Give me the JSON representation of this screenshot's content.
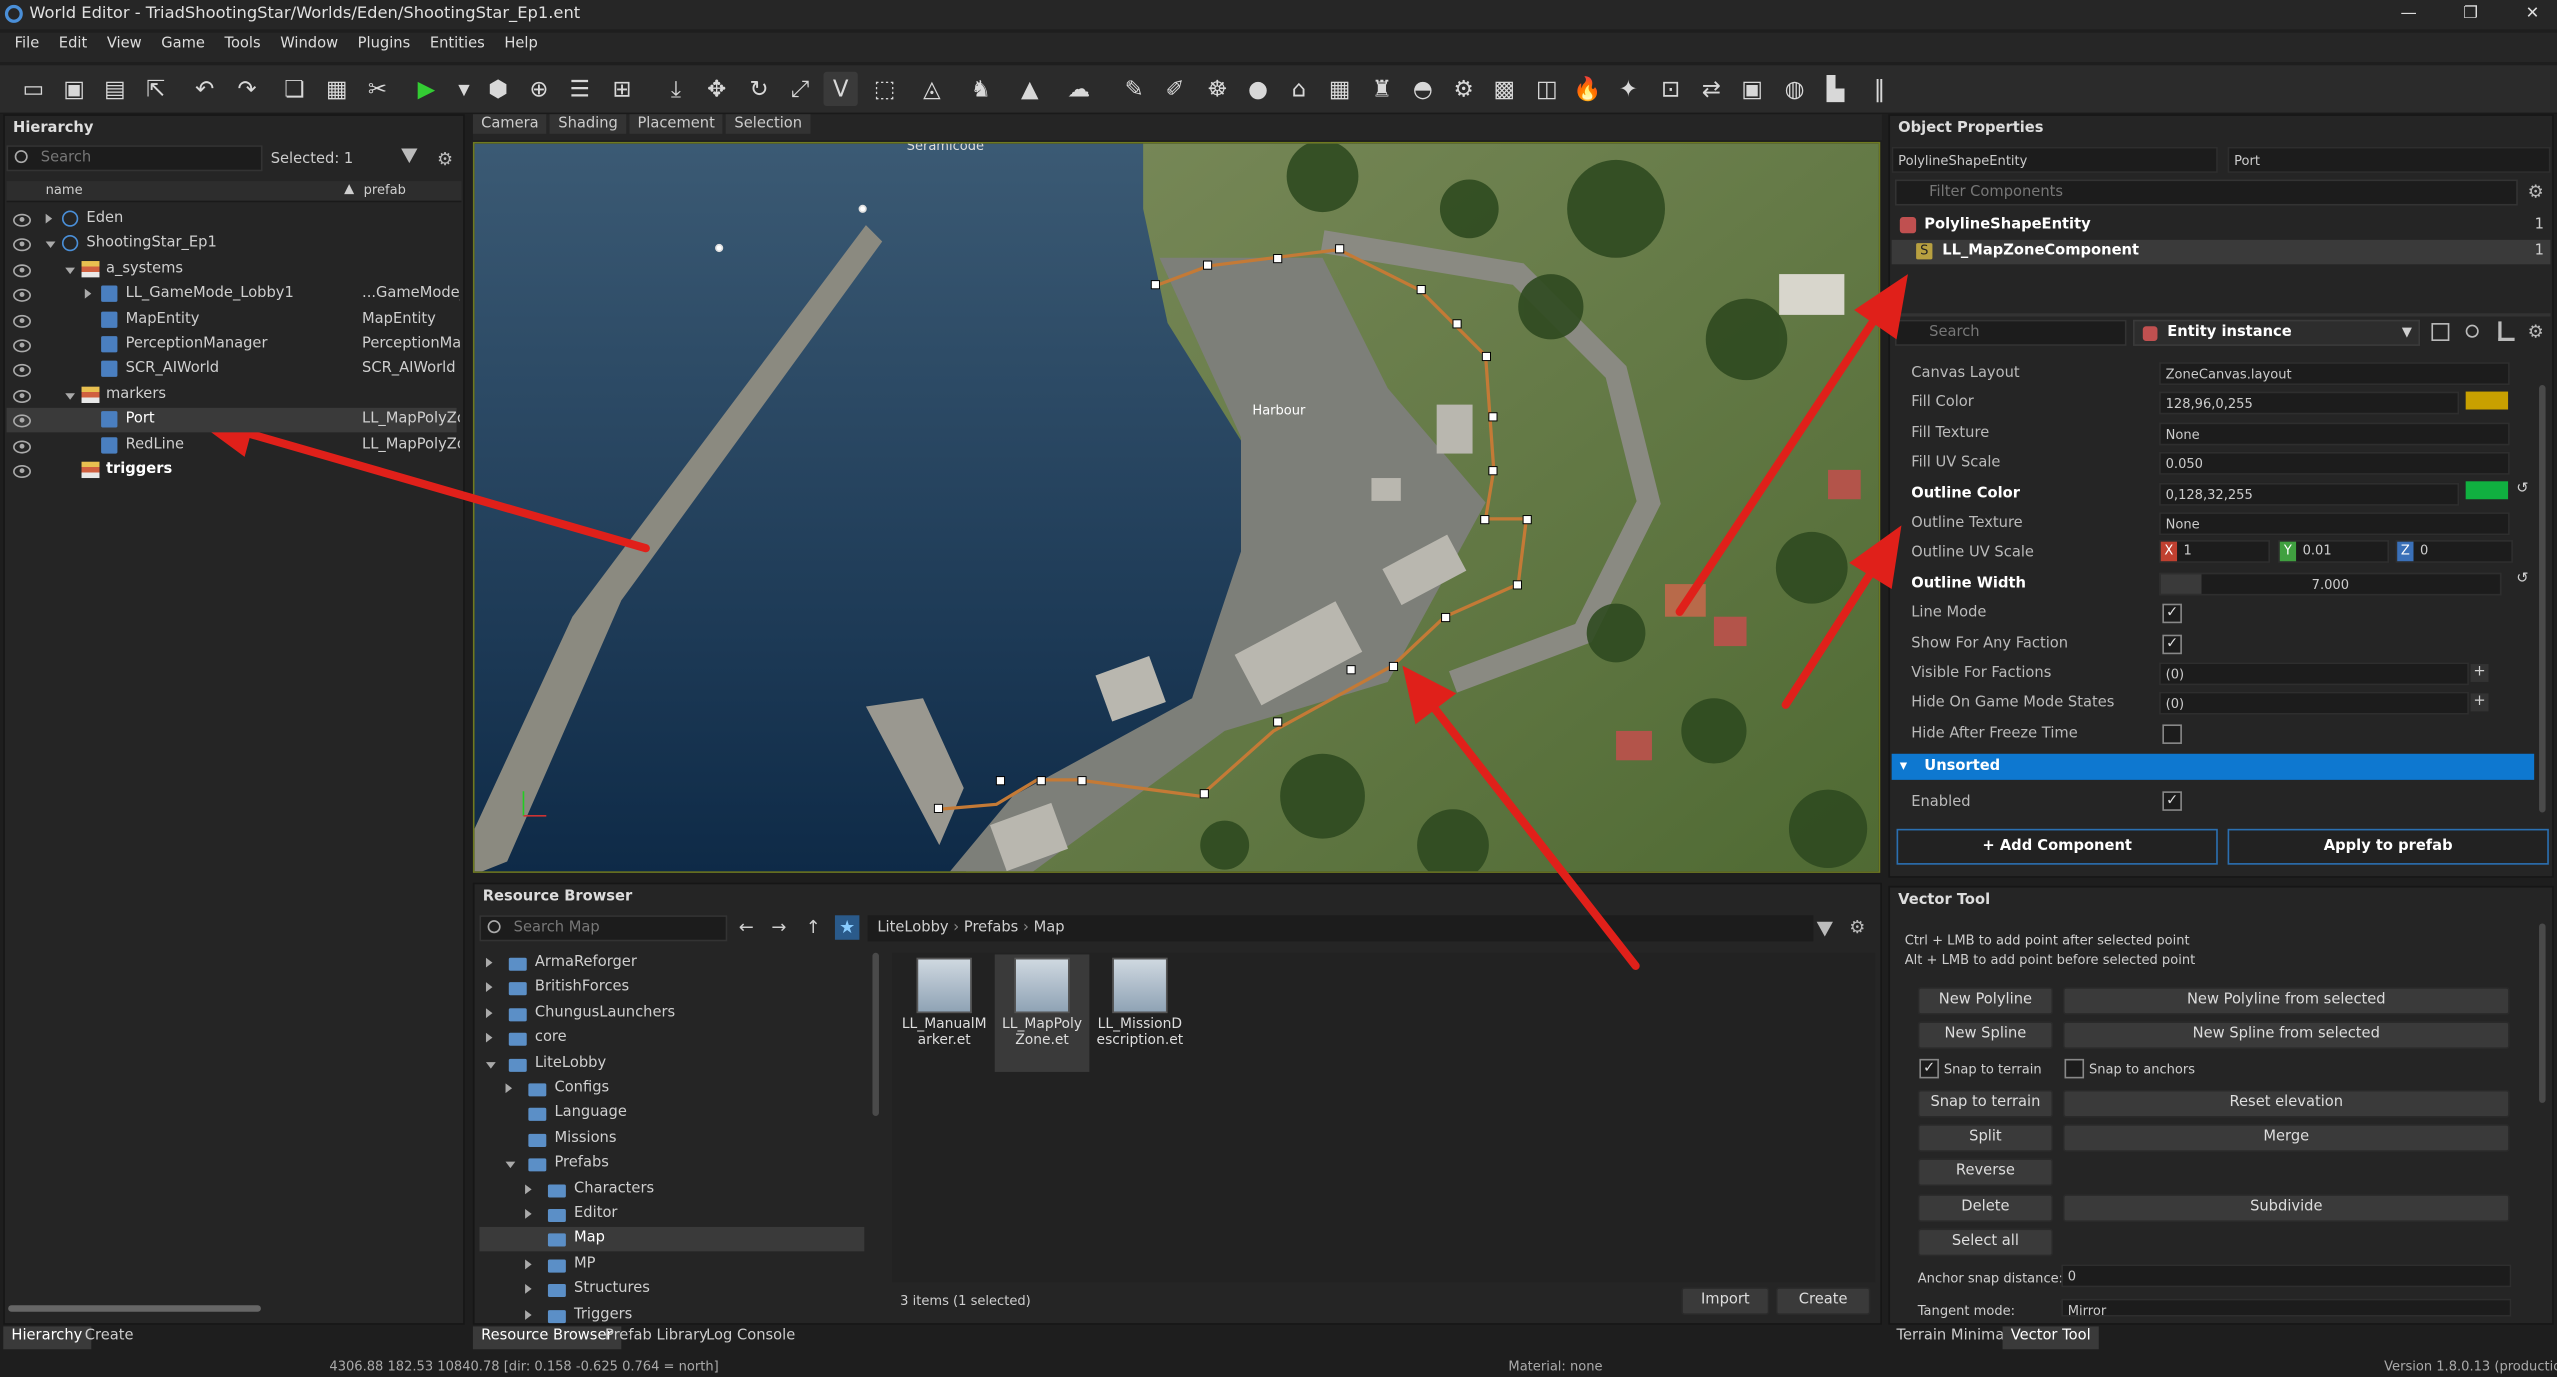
{
  "window": {
    "title": "World Editor - TriadShootingStar/Worlds/Eden/ShootingStar_Ep1.ent",
    "min": "—",
    "max": "❐",
    "close": "✕"
  },
  "menu": [
    "File",
    "Edit",
    "View",
    "Game",
    "Tools",
    "Window",
    "Plugins",
    "Entities",
    "Help"
  ],
  "hierarchy": {
    "title": "Hierarchy",
    "search_placeholder": "Search",
    "selected": "Selected: 1",
    "col_name": "name",
    "col_prefab": "prefab",
    "rows": [
      {
        "name": "Eden",
        "prefab": ""
      },
      {
        "name": "ShootingStar_Ep1",
        "prefab": ""
      },
      {
        "name": "a_systems",
        "prefab": ""
      },
      {
        "name": "LL_GameMode_Lobby1",
        "prefab": "...GameMode_l"
      },
      {
        "name": "MapEntity",
        "prefab": "MapEntity"
      },
      {
        "name": "PerceptionManager",
        "prefab": "PerceptionMar"
      },
      {
        "name": "SCR_AIWorld",
        "prefab": "SCR_AIWorld"
      },
      {
        "name": "markers",
        "prefab": ""
      },
      {
        "name": "Port",
        "prefab": "LL_MapPolyZo"
      },
      {
        "name": "RedLine",
        "prefab": "LL_MapPolyZo"
      },
      {
        "name": "triggers",
        "prefab": ""
      }
    ],
    "tabs": [
      "Hierarchy",
      "Create"
    ]
  },
  "viewport": {
    "tabs": [
      "Camera",
      "Shading",
      "Placement",
      "Selection"
    ],
    "label": "Harbour",
    "top_label": "Seramicode"
  },
  "object_props": {
    "title": "Object Properties",
    "entity_type": "PolylineShapeEntity",
    "entity_name": "Port",
    "filter_placeholder": "Filter Components",
    "components": [
      {
        "name": "PolylineShapeEntity",
        "count": "1"
      },
      {
        "name": "LL_MapZoneComponent",
        "count": "1"
      }
    ],
    "search_placeholder": "Search",
    "instance": "Entity instance",
    "props": [
      {
        "label": "Canvas Layout",
        "value": "ZoneCanvas.layout",
        "bold": false
      },
      {
        "label": "Fill Color",
        "value": "128,96,0,255",
        "bold": false
      },
      {
        "label": "Fill Texture",
        "value": "None",
        "bold": false
      },
      {
        "label": "Fill UV Scale",
        "value": "0.050",
        "bold": false
      },
      {
        "label": "Outline Color",
        "value": "0,128,32,255",
        "bold": true
      },
      {
        "label": "Outline Texture",
        "value": "None",
        "bold": false
      },
      {
        "label": "Outline UV Scale",
        "value": "",
        "bold": false
      },
      {
        "label": "Outline Width",
        "value": "7.000",
        "bold": true
      },
      {
        "label": "Line Mode",
        "value": "",
        "bold": false
      },
      {
        "label": "Show For Any Faction",
        "value": "",
        "bold": false
      },
      {
        "label": "Visible For Factions",
        "value": "(0)",
        "bold": false
      },
      {
        "label": "Hide On Game Mode States",
        "value": "(0)",
        "bold": false
      },
      {
        "label": "Hide After Freeze Time",
        "value": "",
        "bold": false
      }
    ],
    "uv": {
      "x": "1",
      "y": "0.01",
      "z": "0"
    },
    "unsorted": "Unsorted",
    "enabled": "Enabled",
    "add_component": "+ Add Component",
    "apply_prefab": "Apply to prefab",
    "fill_color_hex": "#c8a000",
    "outline_color_hex": "#10b040"
  },
  "resource": {
    "title": "Resource Browser",
    "search_placeholder": "Search Map",
    "crumbs": [
      "LiteLobby",
      "Prefabs",
      "Map"
    ],
    "tree": [
      {
        "name": "ArmaReforger",
        "indent": 0,
        "exp": "r"
      },
      {
        "name": "BritishForces",
        "indent": 0,
        "exp": "r"
      },
      {
        "name": "ChungusLaunchers",
        "indent": 0,
        "exp": "r"
      },
      {
        "name": "core",
        "indent": 0,
        "exp": "r"
      },
      {
        "name": "LiteLobby",
        "indent": 0,
        "exp": "d"
      },
      {
        "name": "Configs",
        "indent": 1,
        "exp": "r"
      },
      {
        "name": "Language",
        "indent": 1,
        "exp": ""
      },
      {
        "name": "Missions",
        "indent": 1,
        "exp": ""
      },
      {
        "name": "Prefabs",
        "indent": 1,
        "exp": "d"
      },
      {
        "name": "Characters",
        "indent": 2,
        "exp": "r"
      },
      {
        "name": "Editor",
        "indent": 2,
        "exp": "r"
      },
      {
        "name": "Map",
        "indent": 2,
        "exp": "",
        "sel": true
      },
      {
        "name": "MP",
        "indent": 2,
        "exp": "r"
      },
      {
        "name": "Structures",
        "indent": 2,
        "exp": "r"
      },
      {
        "name": "Triggers",
        "indent": 2,
        "exp": "r"
      }
    ],
    "files": [
      {
        "line1": "LL_ManualM",
        "line2": "arker.et"
      },
      {
        "line1": "LL_MapPoly",
        "line2": "Zone.et"
      },
      {
        "line1": "LL_MissionD",
        "line2": "escription.et"
      }
    ],
    "status": "3 items (1 selected)",
    "import": "Import",
    "create": "Create",
    "tabs": [
      "Resource Browser",
      "Prefab Library",
      "Log Console"
    ]
  },
  "vector": {
    "title": "Vector Tool",
    "hint1": "Ctrl + LMB to add point after selected point",
    "hint2": "Alt + LMB to add point before selected point",
    "new_polyline": "New Polyline",
    "new_polyline_sel": "New Polyline from selected",
    "new_spline": "New Spline",
    "new_spline_sel": "New Spline from selected",
    "snap_terrain_chk": "Snap to terrain",
    "snap_anchors_chk": "Snap to anchors",
    "snap_terrain_btn": "Snap to terrain",
    "reset_elev": "Reset elevation",
    "split": "Split",
    "merge": "Merge",
    "reverse": "Reverse",
    "delete": "Delete",
    "subdivide": "Subdivide",
    "select_all": "Select all",
    "anchor_label": "Anchor snap distance:",
    "anchor_val": "0",
    "tangent_label": "Tangent mode:",
    "tangent_val": "Mirror",
    "tabs": [
      "Terrain Minimap",
      "Vector Tool"
    ]
  },
  "status": {
    "coords": "4306.88    182.53   10840.78 [dir: 0.158 -0.625  0.764 = north]",
    "material": "Material: none",
    "version": "Version 1.8.0.13 (production)"
  }
}
